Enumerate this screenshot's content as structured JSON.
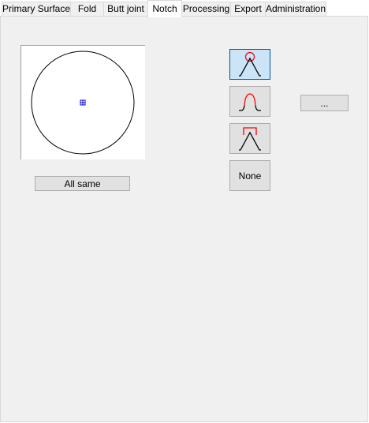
{
  "tabs": [
    {
      "label": "Primary Surface"
    },
    {
      "label": "Fold"
    },
    {
      "label": "Butt joint"
    },
    {
      "label": "Notch",
      "active": true
    },
    {
      "label": "Processing"
    },
    {
      "label": "Export"
    },
    {
      "label": "Administration"
    }
  ],
  "notch": {
    "all_same_label": "All same",
    "none_label": "None",
    "more_label": "...",
    "options": [
      {
        "icon": "notch-circular-icon",
        "selected": true
      },
      {
        "icon": "notch-rounded-icon",
        "selected": false
      },
      {
        "icon": "notch-rectangular-icon",
        "selected": false
      }
    ]
  },
  "colors": {
    "accent_selected": "#cce4f7",
    "accent_border": "#005499",
    "notch_highlight": "#ff0000",
    "center_marker": "#0000cc"
  }
}
